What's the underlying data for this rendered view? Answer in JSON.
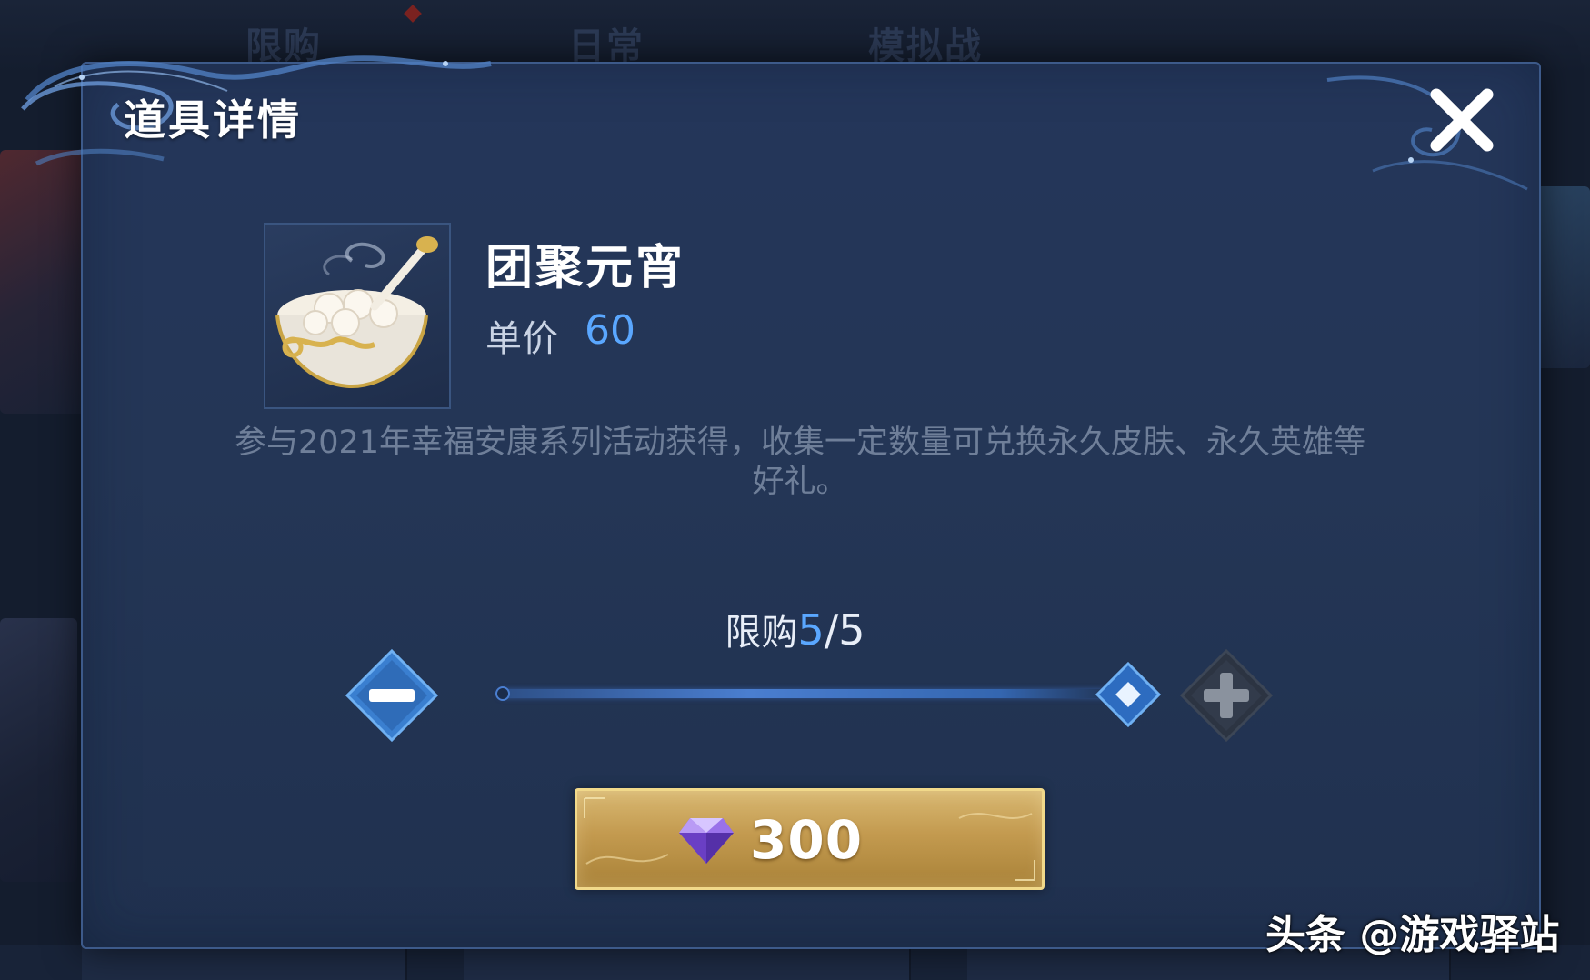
{
  "background": {
    "tabs": [
      "限购",
      "日常",
      "模拟战"
    ]
  },
  "dialog": {
    "title": "道具详情",
    "close_icon": "close-icon"
  },
  "item": {
    "name": "团聚元宵",
    "price_label": "单价",
    "price_value": "60",
    "image_icon": "tangyuan-bowl-icon",
    "description": "参与2021年幸福安康系列活动获得，收集一定数量可兑换永久皮肤、永久英雄等好礼。"
  },
  "quantity": {
    "label": "限购",
    "current": "5",
    "separator": "/",
    "max": "5",
    "selected_fraction": 1.0,
    "minus_icon": "minus-icon",
    "plus_icon": "plus-icon",
    "plus_enabled": false
  },
  "purchase": {
    "currency_icon": "diamond-gem-icon",
    "amount": "300"
  },
  "watermark": {
    "text": "头条 @游戏驿站"
  },
  "colors": {
    "accent_blue": "#5aa7ff",
    "gold_button": "#c39a4f",
    "panel": "#24365a"
  }
}
